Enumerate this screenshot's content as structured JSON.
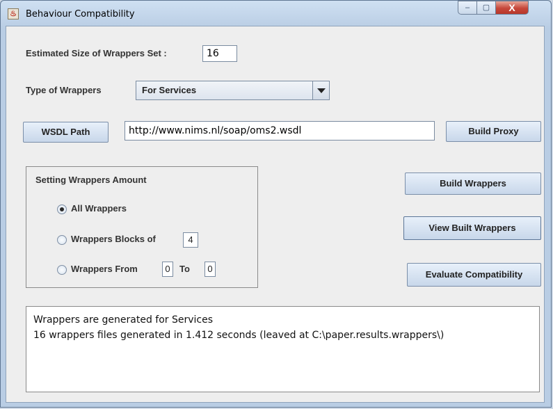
{
  "window": {
    "title": "Behaviour Compatibility"
  },
  "titlebar_controls": {
    "minimize": "–",
    "maximize": "▢",
    "close": "X"
  },
  "size": {
    "label": "Estimated Size of Wrappers Set :",
    "value": "16"
  },
  "type": {
    "label": "Type of Wrappers",
    "selected": "For Services"
  },
  "wsdl": {
    "button": "WSDL Path",
    "path": "http://www.nims.nl/soap/oms2.wsdl",
    "build_proxy": "Build Proxy"
  },
  "amount": {
    "title": "Setting Wrappers Amount",
    "all": "All Wrappers",
    "blocks_label": "Wrappers Blocks of",
    "blocks_value": "4",
    "from_label": "Wrappers  From",
    "from_value": "0",
    "to_label": "To",
    "to_value": "0"
  },
  "actions": {
    "build": "Build Wrappers",
    "view": "View Built Wrappers",
    "evaluate": "Evaluate Compatibility"
  },
  "log": {
    "lines": [
      "Wrappers are generated for Services",
      "16 wrappers files generated in 1.412 seconds  (leaved at C:\\paper.results.wrappers\\)"
    ]
  }
}
